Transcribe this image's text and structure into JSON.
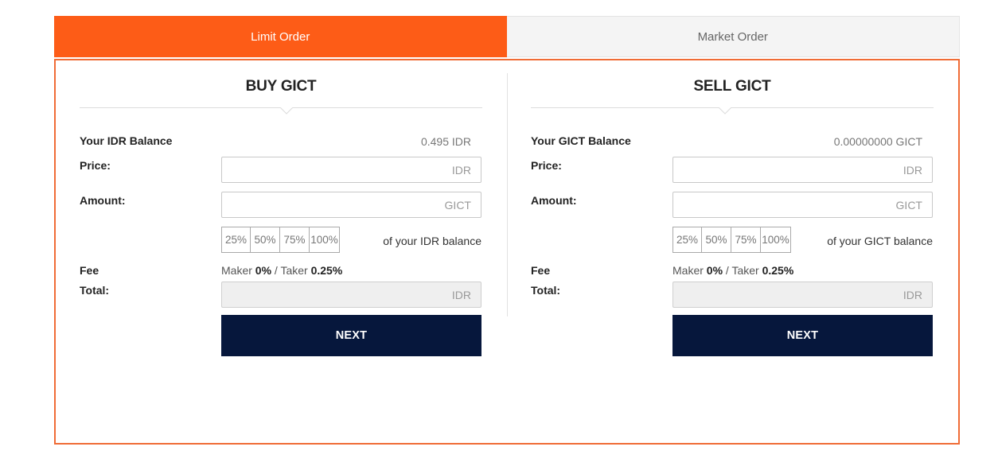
{
  "tabs": {
    "limit": "Limit Order",
    "market": "Market Order"
  },
  "colors": {
    "accent": "#fd5c17",
    "button": "#06173c",
    "border": "#f06c36"
  },
  "buy": {
    "title": "BUY GICT",
    "balance_label": "Your IDR Balance",
    "balance_value": "0.495 IDR",
    "price_label": "Price:",
    "price_placeholder": "IDR",
    "amount_label": "Amount:",
    "amount_placeholder": "GICT",
    "percents": [
      "25%",
      "50%",
      "75%",
      "100%"
    ],
    "percent_caption": "of your IDR balance",
    "fee_label": "Fee",
    "fee_maker_prefix": "Maker ",
    "fee_maker": "0%",
    "fee_sep": " / Taker ",
    "fee_taker": "0.25%",
    "total_label": "Total:",
    "total_placeholder": "IDR",
    "next_label": "NEXT"
  },
  "sell": {
    "title": "SELL GICT",
    "balance_label": "Your GICT Balance",
    "balance_value": "0.00000000 GICT",
    "price_label": "Price:",
    "price_placeholder": "IDR",
    "amount_label": "Amount:",
    "amount_placeholder": "GICT",
    "percents": [
      "25%",
      "50%",
      "75%",
      "100%"
    ],
    "percent_caption": "of your GICT balance",
    "fee_label": "Fee",
    "fee_maker_prefix": "Maker ",
    "fee_maker": "0%",
    "fee_sep": " / Taker ",
    "fee_taker": "0.25%",
    "total_label": "Total:",
    "total_placeholder": "IDR",
    "next_label": "NEXT"
  }
}
